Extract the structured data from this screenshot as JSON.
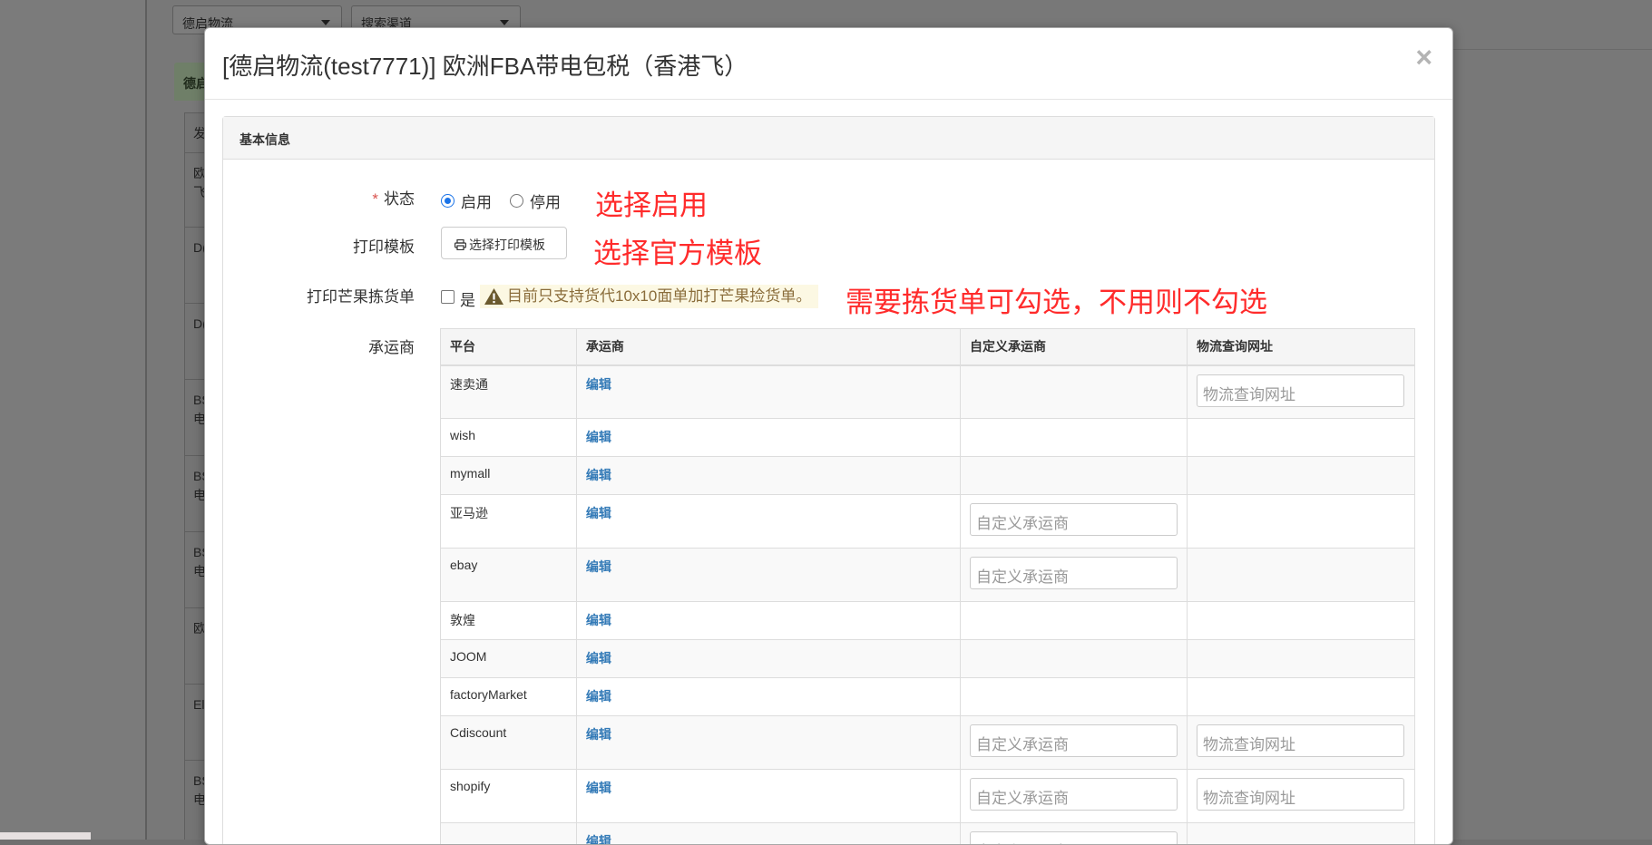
{
  "background": {
    "select_logistics": "德启物流",
    "select_channel": "搜索渠道",
    "panel_head": "德启",
    "col_header": "发",
    "rows": [
      "欧\n飞",
      "D(",
      "D(",
      "BS\n电",
      "BS\n电",
      "BS\n电",
      "欧",
      "El",
      "BS\n电"
    ]
  },
  "modal": {
    "title": "[德启物流(test7771)] 欧洲FBA带电包税（香港飞）",
    "close": "×",
    "panel_heading": "基本信息",
    "status": {
      "required_mark": "*",
      "label": "状态",
      "option_enable": "启用",
      "option_disable": "停用",
      "selected": "启用"
    },
    "print_template": {
      "label": "打印模板",
      "button": "选择打印模板"
    },
    "mango_pick": {
      "label": "打印芒果拣货单",
      "checkbox_label": "是",
      "warning": "目前只支持货代10x10面单加打芒果捡货单。"
    },
    "annotations": {
      "status": "选择启用",
      "template": "选择官方模板",
      "mango": "需要拣货单可勾选，不用则不勾选"
    },
    "carriers": {
      "label": "承运商",
      "columns": [
        "平台",
        "承运商",
        "自定义承运商",
        "物流查询网址"
      ],
      "edit_label": "编辑",
      "custom_placeholder": "自定义承运商",
      "url_placeholder": "物流查询网址",
      "rows": [
        {
          "platform": "速卖通",
          "custom": false,
          "url": true
        },
        {
          "platform": "wish",
          "custom": false,
          "url": false
        },
        {
          "platform": "mymall",
          "custom": false,
          "url": false
        },
        {
          "platform": "亚马逊",
          "custom": true,
          "url": false
        },
        {
          "platform": "ebay",
          "custom": true,
          "url": false
        },
        {
          "platform": "敦煌",
          "custom": false,
          "url": false
        },
        {
          "platform": "JOOM",
          "custom": false,
          "url": false
        },
        {
          "platform": "factoryMarket",
          "custom": false,
          "url": false
        },
        {
          "platform": "Cdiscount",
          "custom": true,
          "url": true
        },
        {
          "platform": "shopify",
          "custom": true,
          "url": true
        },
        {
          "platform": "",
          "custom": true,
          "url": false
        }
      ]
    }
  }
}
